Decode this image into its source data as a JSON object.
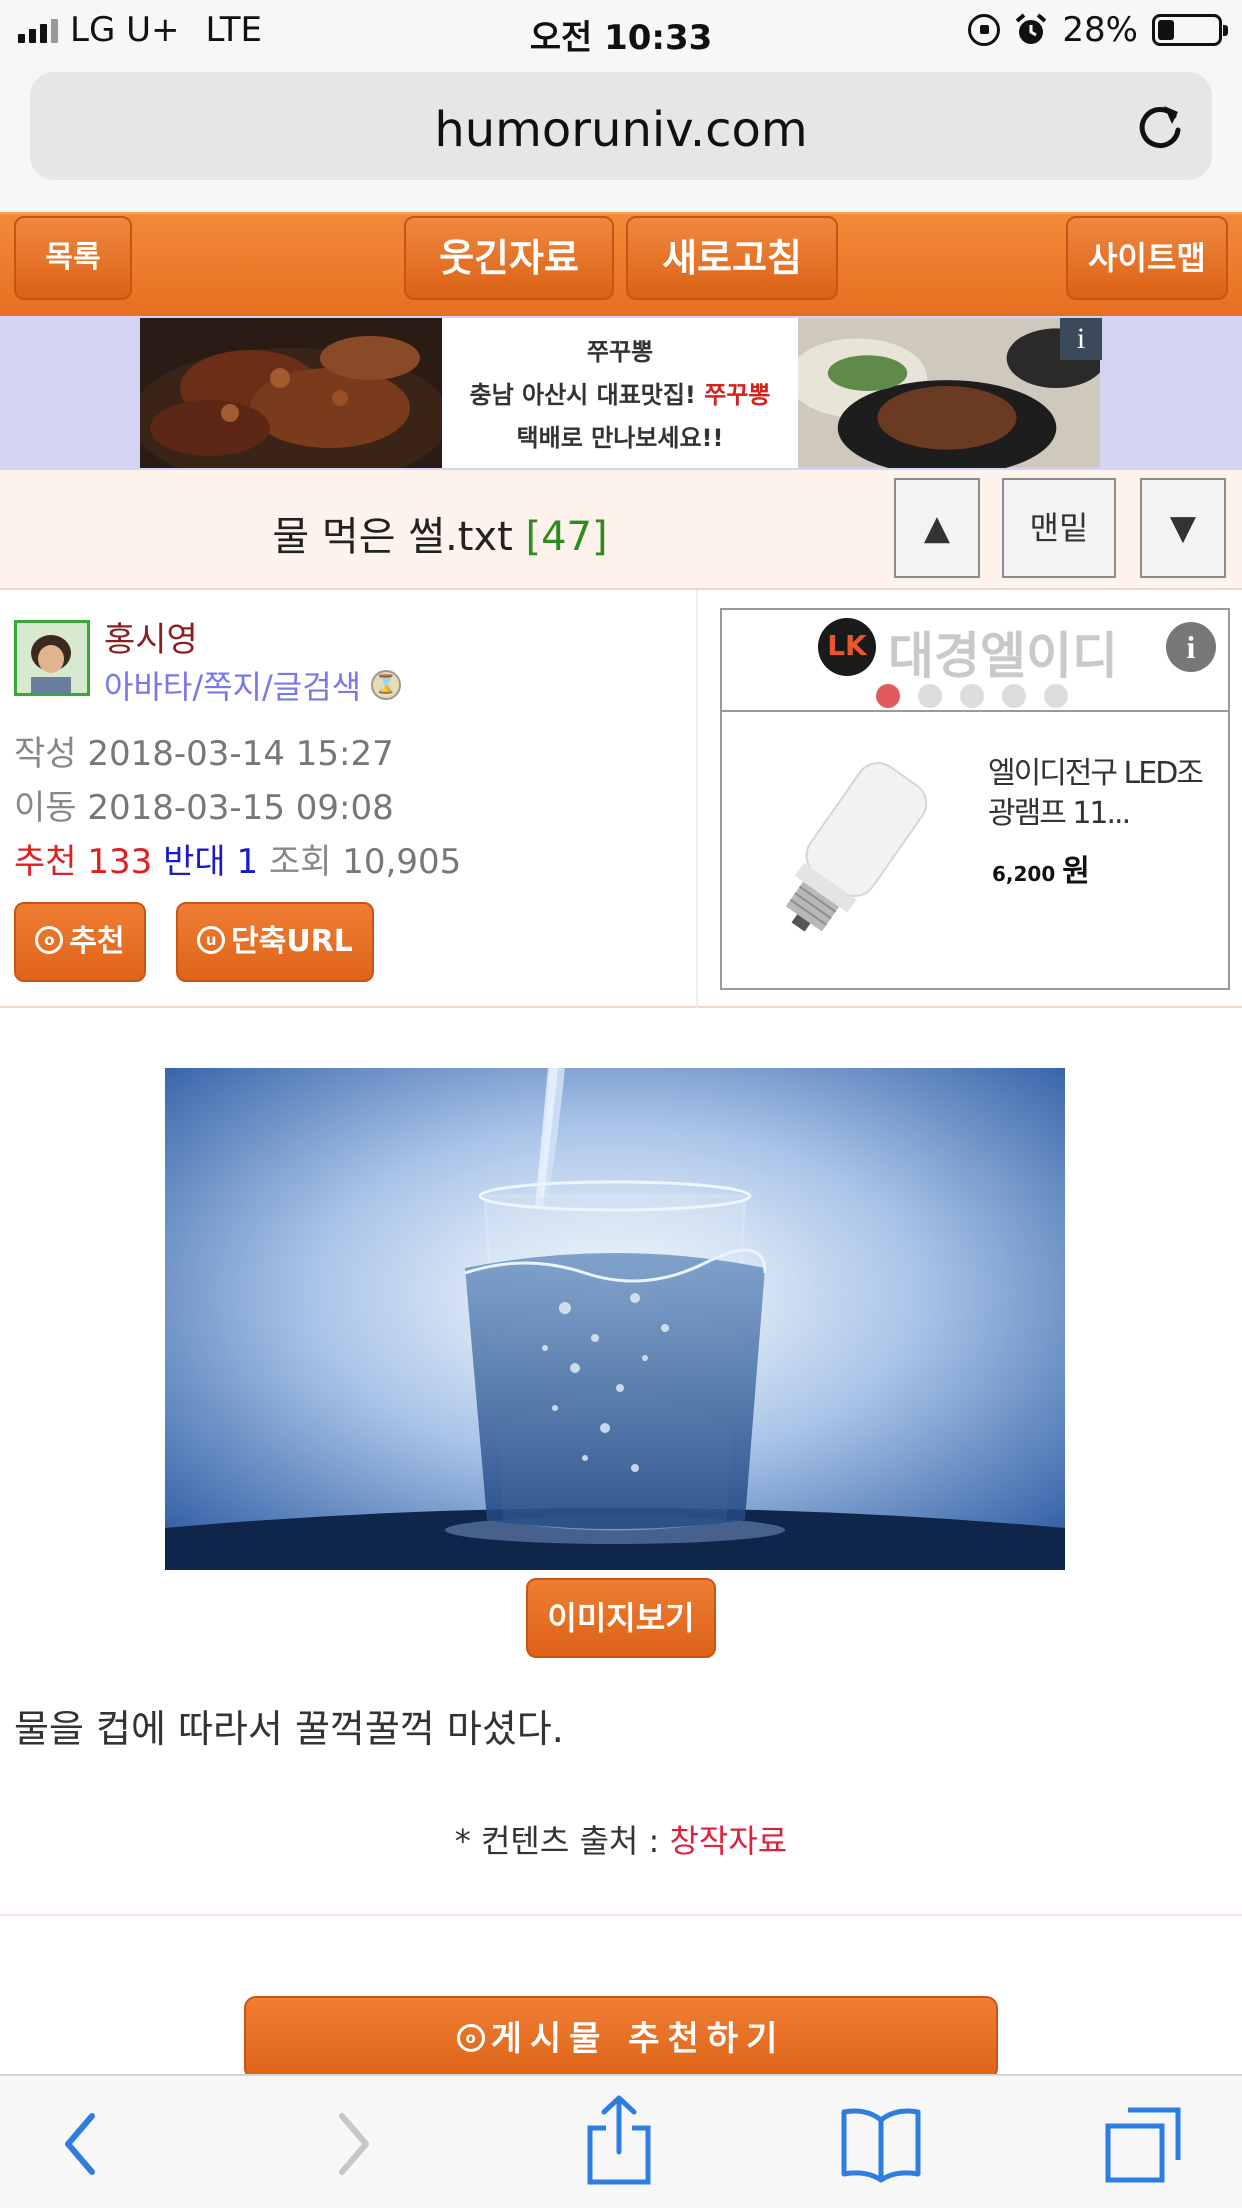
{
  "status_bar": {
    "carrier": "LG U+",
    "network": "LTE",
    "time": "오전 10:33",
    "battery": "28%",
    "battery_level": 0.28,
    "icons": [
      "signal-bars-icon",
      "rotation-lock-icon",
      "alarm-icon",
      "battery-icon"
    ]
  },
  "browser": {
    "url": "humoruniv.com",
    "reload_icon": "reload-icon"
  },
  "nav": {
    "list": "목록",
    "funny": "웃긴자료",
    "refresh": "새로고침",
    "sitemap": "사이트맵"
  },
  "banner": {
    "brand": "쭈꾸뽕",
    "line1_prefix": "충남 아산시 대표맛집! ",
    "line1_highlight": "쭈꾸뽕",
    "line2": "택배로 만나보세요!!",
    "info": "i"
  },
  "post": {
    "title": "물 먹은 썰.txt",
    "comment_count": "[47]",
    "top_label": "맨밑",
    "up_icon": "▲",
    "down_icon": "▼"
  },
  "author": {
    "name": "홍시영",
    "links": "아바타/쪽지/글검색",
    "written_label": "작성",
    "written": "2018-03-14 15:27",
    "moved_label": "이동",
    "moved": "2018-03-15 09:08",
    "recommend_label": "추천",
    "recommend": "133",
    "oppose_label": "반대",
    "oppose": "1",
    "views_label": "조회",
    "views": "10,905"
  },
  "actions": {
    "recommend": "추천",
    "short_url": "단축URL"
  },
  "ad": {
    "brand": "대경엘이디",
    "logo_letters": "LK",
    "info": "i",
    "product": "엘이디전구 LED조광램프 11...",
    "price": "6,200",
    "currency": "원",
    "slide_count": 5,
    "active_slide": 1
  },
  "content": {
    "view_image": "이미지보기",
    "text": "물을 컵에 따라서 꿀꺽꿀꺽 마셨다.",
    "source_label": "* 컨텐츠 출처 : ",
    "source_value": "창작자료",
    "recommend_post": "게시물 추천하기"
  },
  "toolbar": {
    "icons": [
      "back-icon",
      "forward-icon",
      "share-icon",
      "bookmarks-icon",
      "tabs-icon"
    ]
  },
  "colors": {
    "accent": "#e8712a",
    "title_count": "#2e8b1e",
    "link": "#7878e8",
    "author": "#8b1f1f",
    "red": "#e02020",
    "blue": "#1a1ac8"
  }
}
